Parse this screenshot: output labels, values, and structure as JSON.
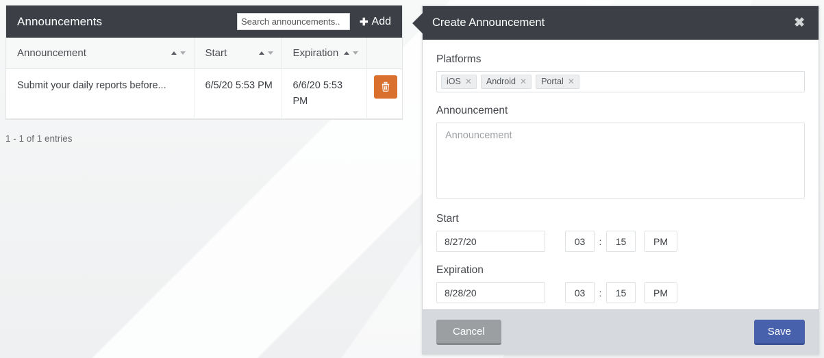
{
  "panel": {
    "title": "Announcements",
    "search": {
      "placeholder": "Search announcements..",
      "value": ""
    },
    "add_label": "Add",
    "add_icon": "plus-icon",
    "columns": [
      {
        "label": "Announcement",
        "sortable": true
      },
      {
        "label": "Start",
        "sortable": true
      },
      {
        "label": "Expiration",
        "sortable": true
      },
      {
        "label": "",
        "sortable": false
      }
    ],
    "rows": [
      {
        "announcement": "Submit your daily reports before...",
        "start": "6/5/20 5:53 PM",
        "expiration": "6/6/20 5:53 PM",
        "delete_icon": "trash-icon"
      }
    ],
    "entries_info": "1 - 1 of 1 entries"
  },
  "modal": {
    "title": "Create Announcement",
    "close_icon": "close-icon",
    "platforms": {
      "label": "Platforms",
      "tags": [
        {
          "label": "iOS",
          "remove_icon": "remove-tag-icon"
        },
        {
          "label": "Android",
          "remove_icon": "remove-tag-icon"
        },
        {
          "label": "Portal",
          "remove_icon": "remove-tag-icon"
        }
      ]
    },
    "announcement": {
      "label": "Announcement",
      "placeholder": "Announcement",
      "value": ""
    },
    "start": {
      "label": "Start",
      "date": "8/27/20",
      "hour": "03",
      "separator": ":",
      "minute": "15",
      "meridiem": "PM"
    },
    "expiration": {
      "label": "Expiration",
      "date": "8/28/20",
      "hour": "03",
      "separator": ":",
      "minute": "15",
      "meridiem": "PM"
    },
    "cancel_label": "Cancel",
    "save_label": "Save"
  },
  "colors": {
    "header_dark": "#3c3f46",
    "delete_orange": "#d9702d",
    "save_blue": "#4761ad",
    "cancel_gray": "#9b9fa2",
    "footer_bg": "#d6dade"
  }
}
